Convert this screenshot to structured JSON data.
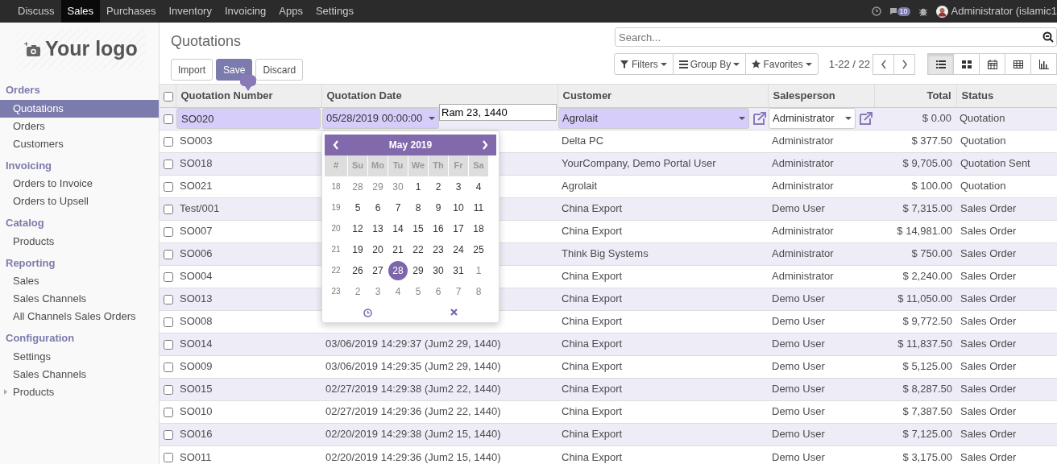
{
  "top_menu": [
    {
      "label": "Discuss",
      "selected": false
    },
    {
      "label": "Sales",
      "selected": true
    },
    {
      "label": "Purchases",
      "selected": false
    },
    {
      "label": "Inventory",
      "selected": false
    },
    {
      "label": "Invoicing",
      "selected": false
    },
    {
      "label": "Apps",
      "selected": false
    },
    {
      "label": "Settings",
      "selected": false
    }
  ],
  "systray": {
    "message_count": "10",
    "user": "Administrator (islamic1"
  },
  "logo": {
    "text": "Your logo"
  },
  "sidebar": [
    {
      "heading": "Orders",
      "items": [
        {
          "label": "Quotations",
          "selected": true,
          "kind": "link"
        },
        {
          "label": "Orders",
          "selected": false,
          "kind": "link"
        },
        {
          "label": "Customers",
          "selected": false,
          "kind": "link"
        }
      ]
    },
    {
      "heading": "Invoicing",
      "items": [
        {
          "label": "Orders to Invoice",
          "selected": false,
          "kind": "link"
        },
        {
          "label": "Orders to Upsell",
          "selected": false,
          "kind": "link"
        }
      ]
    },
    {
      "heading": "Catalog",
      "items": [
        {
          "label": "Products",
          "selected": false,
          "kind": "link"
        }
      ]
    },
    {
      "heading": "Reporting",
      "items": [
        {
          "label": "Sales",
          "selected": false,
          "kind": "link"
        },
        {
          "label": "Sales Channels",
          "selected": false,
          "kind": "link"
        },
        {
          "label": "All Channels Sales Orders",
          "selected": false,
          "kind": "link"
        }
      ]
    },
    {
      "heading": "Configuration",
      "items": [
        {
          "label": "Settings",
          "selected": false,
          "kind": "link"
        },
        {
          "label": "Sales Channels",
          "selected": false,
          "kind": "link"
        },
        {
          "label": "Products",
          "selected": false,
          "kind": "folder",
          "expanded": false
        }
      ]
    }
  ],
  "control_panel": {
    "title": "Quotations",
    "buttons": [
      "Import",
      "Save",
      "Discard"
    ],
    "search": {
      "placeholder": "Search..."
    },
    "filters": [
      "Filters",
      "Group By",
      "Favorites"
    ],
    "pager": "1-22 / 22",
    "views": [
      {
        "kind": "list",
        "selected": true
      },
      {
        "kind": "kanban",
        "selected": false
      },
      {
        "kind": "calendar",
        "selected": false
      },
      {
        "kind": "pivot",
        "selected": false
      },
      {
        "kind": "graph",
        "selected": false
      }
    ]
  },
  "table": {
    "all_checked": false,
    "columns": [
      "Quotation Number",
      "Quotation Date",
      "Customer",
      "Salesperson",
      "Total",
      "Status"
    ],
    "rows": [
      {
        "editing": true,
        "checked": false,
        "number": "SO020",
        "date": "05/28/2019 00:00:00",
        "hijri_date": "Ram 23, 1440",
        "customer": "Agrolait",
        "salesperson": "Administrator",
        "total": "$ 0.00",
        "status": "Quotation"
      },
      {
        "editing": false,
        "checked": false,
        "number": "SO003",
        "customer": "Delta PC",
        "salesperson": "Administrator",
        "total": "$ 377.50",
        "status": "Quotation"
      },
      {
        "editing": false,
        "checked": false,
        "number": "SO018",
        "customer": "YourCompany, Demo Portal User",
        "salesperson": "Administrator",
        "total": "$ 9,705.00",
        "status": "Quotation Sent"
      },
      {
        "editing": false,
        "checked": false,
        "number": "SO021",
        "customer": "Agrolait",
        "salesperson": "Administrator",
        "total": "$ 100.00",
        "status": "Quotation"
      },
      {
        "editing": false,
        "checked": false,
        "number": "Test/001",
        "customer": "China Export",
        "salesperson": "Demo User",
        "total": "$ 7,315.00",
        "status": "Sales Order"
      },
      {
        "editing": false,
        "checked": false,
        "number": "SO007",
        "customer": "China Export",
        "salesperson": "Administrator",
        "total": "$ 14,981.00",
        "status": "Sales Order"
      },
      {
        "editing": false,
        "checked": false,
        "number": "SO006",
        "customer": "Think Big Systems",
        "salesperson": "Administrator",
        "total": "$ 750.00",
        "status": "Sales Order"
      },
      {
        "editing": false,
        "checked": false,
        "number": "SO004",
        "customer": "China Export",
        "salesperson": "Administrator",
        "total": "$ 2,240.00",
        "status": "Sales Order"
      },
      {
        "editing": false,
        "checked": false,
        "number": "SO013",
        "customer": "China Export",
        "salesperson": "Demo User",
        "total": "$ 11,050.00",
        "status": "Sales Order"
      },
      {
        "editing": false,
        "checked": false,
        "number": "SO008",
        "customer": "China Export",
        "salesperson": "Demo User",
        "total": "$ 9,772.50",
        "status": "Sales Order"
      },
      {
        "editing": false,
        "checked": false,
        "number": "SO014",
        "date": "03/06/2019 14:29:37 (Jum2 29, 1440)",
        "customer": "China Export",
        "salesperson": "Demo User",
        "total": "$ 11,837.50",
        "status": "Sales Order"
      },
      {
        "editing": false,
        "checked": false,
        "number": "SO009",
        "date": "03/06/2019 14:29:35 (Jum2 29, 1440)",
        "customer": "China Export",
        "salesperson": "Demo User",
        "total": "$ 5,125.00",
        "status": "Sales Order"
      },
      {
        "editing": false,
        "checked": false,
        "number": "SO015",
        "date": "02/27/2019 14:29:38 (Jum2 22, 1440)",
        "customer": "China Export",
        "salesperson": "Demo User",
        "total": "$ 8,287.50",
        "status": "Sales Order"
      },
      {
        "editing": false,
        "checked": false,
        "number": "SO010",
        "date": "02/27/2019 14:29:36 (Jum2 22, 1440)",
        "customer": "China Export",
        "salesperson": "Demo User",
        "total": "$ 7,387.50",
        "status": "Sales Order"
      },
      {
        "editing": false,
        "checked": false,
        "number": "SO016",
        "date": "02/20/2019 14:29:38 (Jum2 15, 1440)",
        "customer": "China Export",
        "salesperson": "Demo User",
        "total": "$ 7,125.00",
        "status": "Sales Order"
      },
      {
        "editing": false,
        "checked": false,
        "number": "SO011",
        "date": "02/20/2019 14:29:36 (Jum2 15, 1440)",
        "customer": "China Export",
        "salesperson": "Demo User",
        "total": "$ 3,175.00",
        "status": "Sales Order"
      }
    ]
  },
  "datepicker": {
    "title": "May 2019",
    "week_header": "#",
    "weekdays": [
      "Su",
      "Mo",
      "Tu",
      "We",
      "Th",
      "Fr",
      "Sa"
    ],
    "weeks": [
      {
        "number": "18",
        "days": [
          {
            "day": "28",
            "other_month": true,
            "selected": false
          },
          {
            "day": "29",
            "other_month": true,
            "selected": false
          },
          {
            "day": "30",
            "other_month": true,
            "selected": false
          },
          {
            "day": "1",
            "other_month": false,
            "selected": false
          },
          {
            "day": "2",
            "other_month": false,
            "selected": false
          },
          {
            "day": "3",
            "other_month": false,
            "selected": false
          },
          {
            "day": "4",
            "other_month": false,
            "selected": false
          }
        ]
      },
      {
        "number": "19",
        "days": [
          {
            "day": "5",
            "other_month": false,
            "selected": false
          },
          {
            "day": "6",
            "other_month": false,
            "selected": false
          },
          {
            "day": "7",
            "other_month": false,
            "selected": false
          },
          {
            "day": "8",
            "other_month": false,
            "selected": false
          },
          {
            "day": "9",
            "other_month": false,
            "selected": false
          },
          {
            "day": "10",
            "other_month": false,
            "selected": false
          },
          {
            "day": "11",
            "other_month": false,
            "selected": false
          }
        ]
      },
      {
        "number": "20",
        "days": [
          {
            "day": "12",
            "other_month": false,
            "selected": false
          },
          {
            "day": "13",
            "other_month": false,
            "selected": false
          },
          {
            "day": "14",
            "other_month": false,
            "selected": false
          },
          {
            "day": "15",
            "other_month": false,
            "selected": false
          },
          {
            "day": "16",
            "other_month": false,
            "selected": false
          },
          {
            "day": "17",
            "other_month": false,
            "selected": false
          },
          {
            "day": "18",
            "other_month": false,
            "selected": false
          }
        ]
      },
      {
        "number": "21",
        "days": [
          {
            "day": "19",
            "other_month": false,
            "selected": false
          },
          {
            "day": "20",
            "other_month": false,
            "selected": false
          },
          {
            "day": "21",
            "other_month": false,
            "selected": false
          },
          {
            "day": "22",
            "other_month": false,
            "selected": false
          },
          {
            "day": "23",
            "other_month": false,
            "selected": false
          },
          {
            "day": "24",
            "other_month": false,
            "selected": false
          },
          {
            "day": "25",
            "other_month": false,
            "selected": false
          }
        ]
      },
      {
        "number": "22",
        "days": [
          {
            "day": "26",
            "other_month": false,
            "selected": false
          },
          {
            "day": "27",
            "other_month": false,
            "selected": false
          },
          {
            "day": "28",
            "other_month": false,
            "selected": true
          },
          {
            "day": "29",
            "other_month": false,
            "selected": false
          },
          {
            "day": "30",
            "other_month": false,
            "selected": false
          },
          {
            "day": "31",
            "other_month": false,
            "selected": false
          },
          {
            "day": "1",
            "other_month": true,
            "selected": false
          }
        ]
      },
      {
        "number": "23",
        "days": [
          {
            "day": "2",
            "other_month": true,
            "selected": false
          },
          {
            "day": "3",
            "other_month": true,
            "selected": false
          },
          {
            "day": "4",
            "other_month": true,
            "selected": false
          },
          {
            "day": "5",
            "other_month": true,
            "selected": false
          },
          {
            "day": "6",
            "other_month": true,
            "selected": false
          },
          {
            "day": "7",
            "other_month": true,
            "selected": false
          },
          {
            "day": "8",
            "other_month": true,
            "selected": false
          }
        ]
      }
    ]
  }
}
